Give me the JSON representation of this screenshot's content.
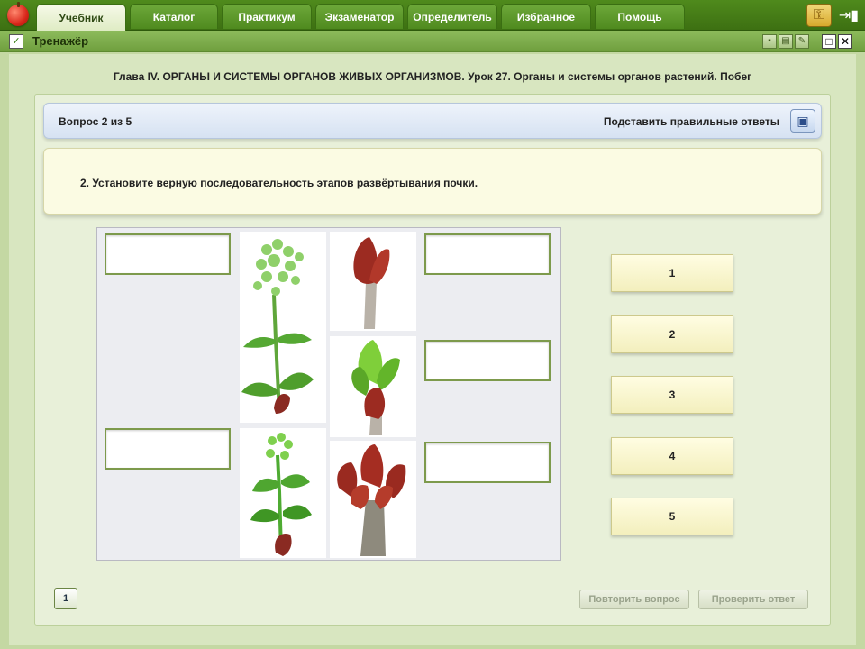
{
  "tabs": [
    "Учебник",
    "Каталог",
    "Практикум",
    "Экзаменатор",
    "Определитель",
    "Избранное",
    "Помощь"
  ],
  "window": {
    "title": "Тренажёр"
  },
  "chapter_title": "Глава IV. ОРГАНЫ И СИСТЕМЫ ОРГАНОВ ЖИВЫХ ОРГАНИЗМОВ. Урок 27. Органы и системы органов растений. Побег",
  "question": {
    "counter": "Вопрос 2 из 5",
    "substitute_label": "Подставить правильные ответы",
    "text": "2. Установите верную последовательность этапов развёртывания почки."
  },
  "answers": [
    "1",
    "2",
    "3",
    "4",
    "5"
  ],
  "footer": {
    "repeat_label": "Повторить вопрос",
    "check_label": "Проверить ответ",
    "counter_icon_label": "1"
  },
  "colors": {
    "accent": "#4f8a1c",
    "panel": "#d8e6c0",
    "answer_bg": "#f8f5cc"
  }
}
